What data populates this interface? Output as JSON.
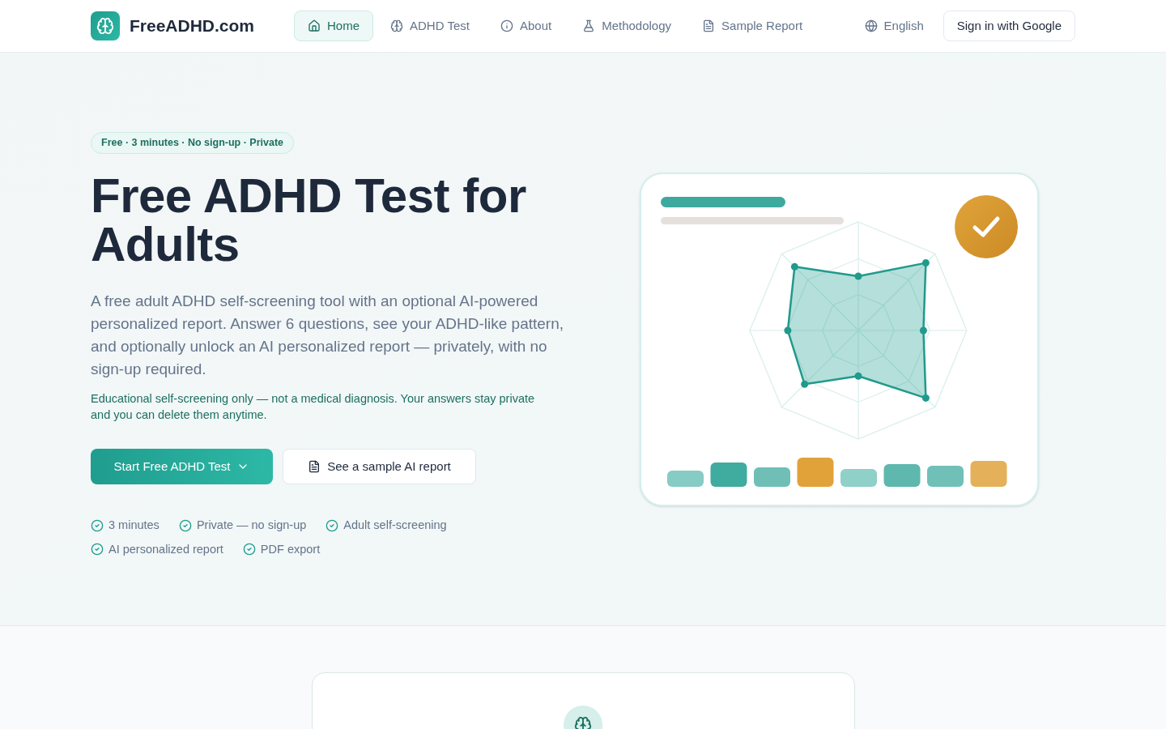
{
  "header": {
    "brand": "FreeADHD.com",
    "nav": [
      {
        "label": "Home",
        "selected": true
      },
      {
        "label": "ADHD Test",
        "selected": false
      },
      {
        "label": "About",
        "selected": false
      },
      {
        "label": "Methodology",
        "selected": false
      },
      {
        "label": "Sample Report",
        "selected": false
      }
    ],
    "language": "English",
    "sign_in": "Sign in with Google"
  },
  "hero": {
    "badge": "Free · 3 minutes · No sign-up · Private",
    "title": "Free ADHD Test for Adults",
    "description": "A free adult ADHD self-screening tool with an optional AI-powered personalized report. Answer 6 questions, see your ADHD-like pattern, and optionally unlock an AI personalized report — privately, with no sign-up required.",
    "disclaimer": "Educational self-screening only — not a medical diagnosis. Your answers stay private and you can delete them anytime.",
    "primary_button": "Start Free ADHD Test",
    "secondary_button": "See a sample AI report",
    "features": [
      "3 minutes",
      "Private — no sign-up",
      "Adult self-screening",
      "AI personalized report",
      "PDF export"
    ]
  }
}
